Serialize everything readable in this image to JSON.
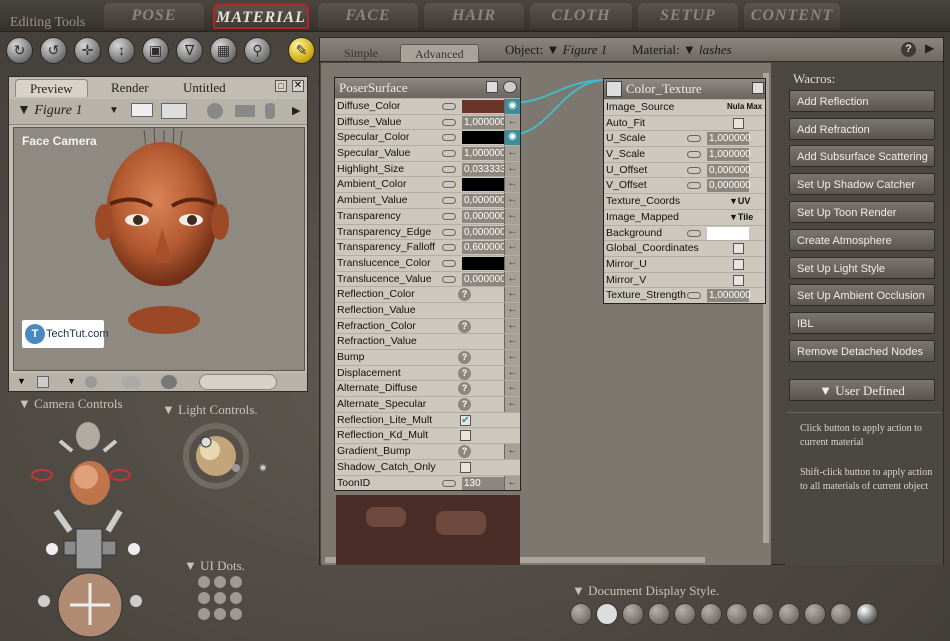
{
  "top_tabs": [
    {
      "label": "POSE",
      "active": false
    },
    {
      "label": "MATERIAL",
      "active": true
    },
    {
      "label": "FACE",
      "active": false
    },
    {
      "label": "HAIR",
      "active": false
    },
    {
      "label": "CLOTH",
      "active": false
    },
    {
      "label": "SETUP",
      "active": false
    },
    {
      "label": "CONTENT",
      "active": false
    }
  ],
  "editing_tools_label": "Editing Tools",
  "preview": {
    "tabs": [
      "Preview",
      "Render",
      "Untitled"
    ],
    "figure_select": "Figure 1",
    "camera_label": "Face Camera",
    "watermark": "TechTut.com",
    "watermark_icon_letter": "T"
  },
  "left_labels": {
    "camera_controls": "Camera Controls",
    "light_controls": "Light Controls.",
    "ui_dots": "UI Dots."
  },
  "material_room": {
    "tabs": [
      "Simple",
      "Advanced"
    ],
    "active_tab": "Advanced",
    "object_label": "Object:",
    "object_value": "Figure 1",
    "material_label": "Material:",
    "material_value": "lashes"
  },
  "poser_surface": {
    "title": "PoserSurface",
    "rows": [
      {
        "label": "Diffuse_Color",
        "kind": "swatch",
        "color": "#6a3428",
        "connected": true
      },
      {
        "label": "Diffuse_Value",
        "kind": "value",
        "value": "1,000000"
      },
      {
        "label": "Specular_Color",
        "kind": "swatch",
        "color": "#000000",
        "connected": true
      },
      {
        "label": "Specular_Value",
        "kind": "value",
        "value": "1,000000"
      },
      {
        "label": "Highlight_Size",
        "kind": "value",
        "value": "0,033333"
      },
      {
        "label": "Ambient_Color",
        "kind": "swatch",
        "color": "#000000"
      },
      {
        "label": "Ambient_Value",
        "kind": "value",
        "value": "0,000000"
      },
      {
        "label": "Transparency",
        "kind": "value",
        "value": "0,000000"
      },
      {
        "label": "Transparency_Edge",
        "kind": "value",
        "value": "0,000000"
      },
      {
        "label": "Transparency_Falloff",
        "kind": "value",
        "value": "0,600000"
      },
      {
        "label": "Translucence_Color",
        "kind": "swatch",
        "color": "#000000"
      },
      {
        "label": "Translucence_Value",
        "kind": "value",
        "value": "0,000000"
      },
      {
        "label": "Reflection_Color",
        "kind": "q"
      },
      {
        "label": "Reflection_Value",
        "kind": "none"
      },
      {
        "label": "Refraction_Color",
        "kind": "q"
      },
      {
        "label": "Refraction_Value",
        "kind": "none"
      },
      {
        "label": "Bump",
        "kind": "q"
      },
      {
        "label": "Displacement",
        "kind": "q"
      },
      {
        "label": "Alternate_Diffuse",
        "kind": "q"
      },
      {
        "label": "Alternate_Specular",
        "kind": "q"
      },
      {
        "label": "Reflection_Lite_Mult",
        "kind": "check",
        "checked": true
      },
      {
        "label": "Reflection_Kd_Mult",
        "kind": "check",
        "checked": false
      },
      {
        "label": "Gradient_Bump",
        "kind": "q"
      },
      {
        "label": "Shadow_Catch_Only",
        "kind": "check",
        "checked": false
      },
      {
        "label": "ToonID",
        "kind": "value",
        "value": "130"
      }
    ]
  },
  "color_texture": {
    "title": "Color_Texture",
    "rows": [
      {
        "label": "Image_Source",
        "kind": "text",
        "value": "Nula Max"
      },
      {
        "label": "Auto_Fit",
        "kind": "check",
        "checked": false
      },
      {
        "label": "U_Scale",
        "kind": "value",
        "value": "1,000000"
      },
      {
        "label": "V_Scale",
        "kind": "value",
        "value": "1,000000"
      },
      {
        "label": "U_Offset",
        "kind": "value",
        "value": "0,000000"
      },
      {
        "label": "V_Offset",
        "kind": "value",
        "value": "0,000000"
      },
      {
        "label": "Texture_Coords",
        "kind": "dropdown",
        "value": "UV"
      },
      {
        "label": "Image_Mapped",
        "kind": "dropdown",
        "value": "Tile"
      },
      {
        "label": "Background",
        "kind": "swatch",
        "color": "#ffffff"
      },
      {
        "label": "Global_Coordinates",
        "kind": "check",
        "checked": false
      },
      {
        "label": "Mirror_U",
        "kind": "check",
        "checked": false
      },
      {
        "label": "Mirror_V",
        "kind": "check",
        "checked": false
      },
      {
        "label": "Texture_Strength",
        "kind": "value",
        "value": "1,000000"
      }
    ]
  },
  "wacros": {
    "title": "Wacros:",
    "buttons": [
      "Add Reflection",
      "Add Refraction",
      "Add Subsurface Scattering",
      "Set Up Shadow Catcher",
      "Set Up Toon Render",
      "Create Atmosphere",
      "Set Up Light Style",
      "Set Up Ambient Occlusion",
      "IBL",
      "Remove Detached Nodes"
    ],
    "user_defined": "User Defined",
    "help_1": "Click button to apply action to current material",
    "help_2": "Shift-click button to apply action to all materials of current object"
  },
  "doc_display_label": "Document Display Style.",
  "colors": {
    "active_tab_border": "#b52424",
    "connection": "#46b8c8"
  }
}
